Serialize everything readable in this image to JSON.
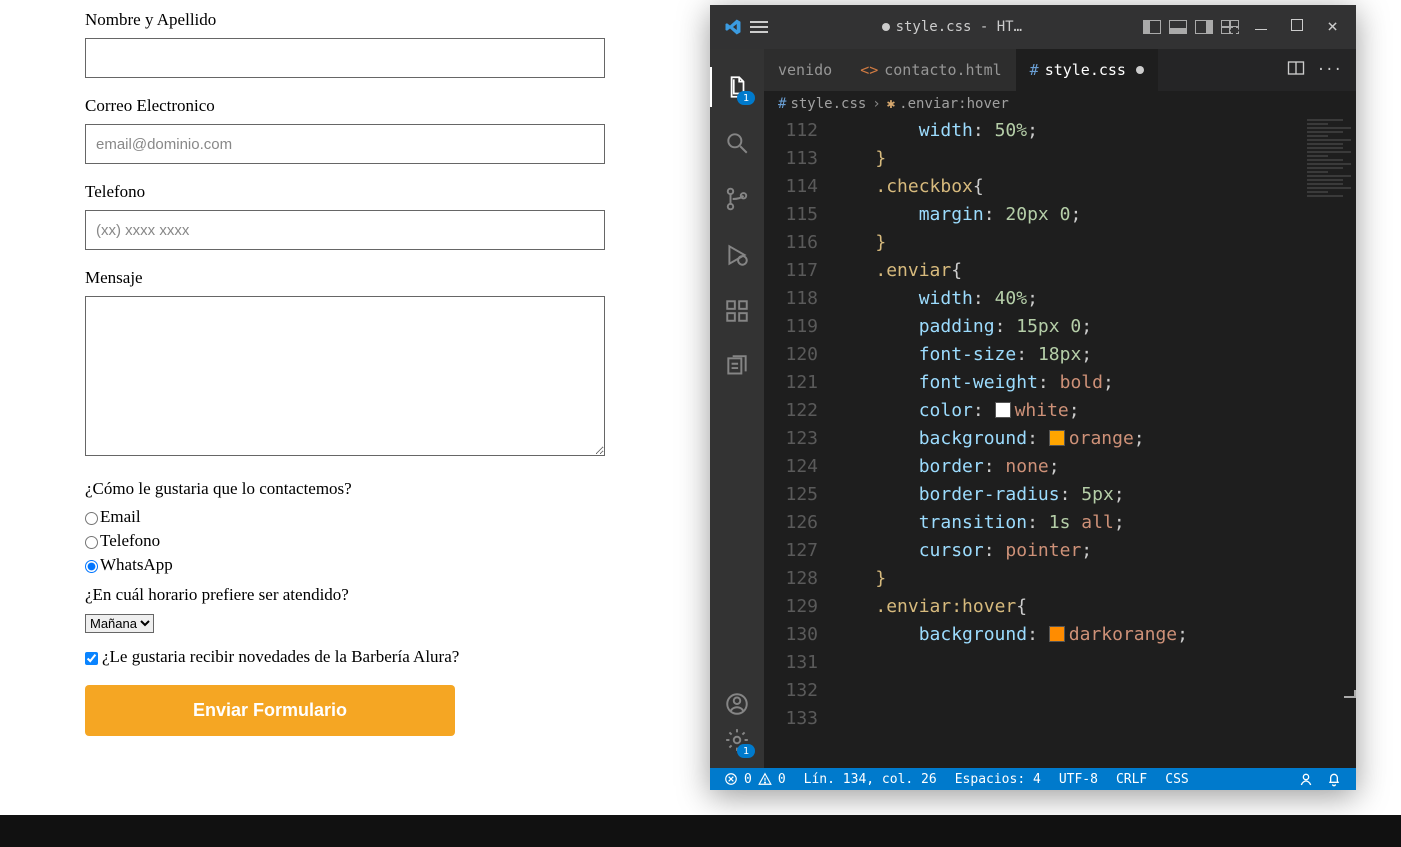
{
  "form": {
    "name_label": "Nombre y Apellido",
    "email_label": "Correo Electronico",
    "email_placeholder": "email@dominio.com",
    "phone_label": "Telefono",
    "phone_placeholder": "(xx) xxxx xxxx",
    "message_label": "Mensaje",
    "contact_question": "¿Cómo le gustaria que lo contactemos?",
    "radios": {
      "email": "Email",
      "telefono": "Telefono",
      "whatsapp": "WhatsApp"
    },
    "schedule_question": "¿En cuál horario prefiere ser atendido?",
    "schedule_selected": "Mañana",
    "newsletter": "¿Le gustaria recibir novedades de la Barbería Alura?",
    "submit": "Enviar Formulario"
  },
  "vscode": {
    "title": "style.css - HTML...",
    "actbar": {
      "explorer_badge": "1",
      "settings_badge": "1"
    },
    "tabs": {
      "welcome": "venido",
      "contacto": "contacto.html",
      "style": "style.css"
    },
    "breadcrumb": {
      "file": "style.css",
      "symbol": ".enviar:hover"
    },
    "lines": [
      {
        "n": "112",
        "ind": 2,
        "t": [
          [
            "prop",
            "width"
          ],
          [
            "punc",
            ": "
          ],
          [
            "num",
            "50%"
          ],
          [
            "punc",
            ";"
          ]
        ]
      },
      {
        "n": "113",
        "ind": 1,
        "t": [
          [
            "sel",
            "}"
          ]
        ]
      },
      {
        "n": "114",
        "ind": 0,
        "t": []
      },
      {
        "n": "115",
        "ind": 1,
        "t": [
          [
            "sel",
            ".checkbox"
          ],
          [
            "punc",
            "{"
          ]
        ]
      },
      {
        "n": "116",
        "ind": 2,
        "t": [
          [
            "prop",
            "margin"
          ],
          [
            "punc",
            ": "
          ],
          [
            "num",
            "20px 0"
          ],
          [
            "punc",
            ";"
          ]
        ]
      },
      {
        "n": "117",
        "ind": 1,
        "t": [
          [
            "sel",
            "}"
          ]
        ]
      },
      {
        "n": "118",
        "ind": 0,
        "t": []
      },
      {
        "n": "119",
        "ind": 1,
        "t": [
          [
            "sel",
            ".enviar"
          ],
          [
            "punc",
            "{"
          ]
        ]
      },
      {
        "n": "120",
        "ind": 2,
        "t": [
          [
            "prop",
            "width"
          ],
          [
            "punc",
            ": "
          ],
          [
            "num",
            "40%"
          ],
          [
            "punc",
            ";"
          ]
        ]
      },
      {
        "n": "121",
        "ind": 2,
        "t": [
          [
            "prop",
            "padding"
          ],
          [
            "punc",
            ": "
          ],
          [
            "num",
            "15px 0"
          ],
          [
            "punc",
            ";"
          ]
        ]
      },
      {
        "n": "122",
        "ind": 2,
        "t": [
          [
            "prop",
            "font-size"
          ],
          [
            "punc",
            ": "
          ],
          [
            "num",
            "18px"
          ],
          [
            "punc",
            ";"
          ]
        ]
      },
      {
        "n": "123",
        "ind": 2,
        "t": [
          [
            "prop",
            "font-weight"
          ],
          [
            "punc",
            ": "
          ],
          [
            "const",
            "bold"
          ],
          [
            "punc",
            ";"
          ]
        ]
      },
      {
        "n": "124",
        "ind": 2,
        "t": [
          [
            "prop",
            "color"
          ],
          [
            "punc",
            ": "
          ],
          [
            "swatch",
            "#ffffff"
          ],
          [
            "const",
            "white"
          ],
          [
            "punc",
            ";"
          ]
        ]
      },
      {
        "n": "125",
        "ind": 2,
        "t": [
          [
            "prop",
            "background"
          ],
          [
            "punc",
            ": "
          ],
          [
            "swatch",
            "#ffa500"
          ],
          [
            "const",
            "orange"
          ],
          [
            "punc",
            ";"
          ]
        ]
      },
      {
        "n": "126",
        "ind": 2,
        "t": [
          [
            "prop",
            "border"
          ],
          [
            "punc",
            ": "
          ],
          [
            "const",
            "none"
          ],
          [
            "punc",
            ";"
          ]
        ]
      },
      {
        "n": "127",
        "ind": 2,
        "t": [
          [
            "prop",
            "border-radius"
          ],
          [
            "punc",
            ": "
          ],
          [
            "num",
            "5px"
          ],
          [
            "punc",
            ";"
          ]
        ]
      },
      {
        "n": "128",
        "ind": 2,
        "t": [
          [
            "prop",
            "transition"
          ],
          [
            "punc",
            ": "
          ],
          [
            "num",
            "1s"
          ],
          [
            "punc",
            " "
          ],
          [
            "const",
            "all"
          ],
          [
            "punc",
            ";"
          ]
        ]
      },
      {
        "n": "129",
        "ind": 2,
        "t": [
          [
            "prop",
            "cursor"
          ],
          [
            "punc",
            ": "
          ],
          [
            "const",
            "pointer"
          ],
          [
            "punc",
            ";"
          ]
        ]
      },
      {
        "n": "130",
        "ind": 1,
        "t": [
          [
            "sel",
            "}"
          ]
        ]
      },
      {
        "n": "131",
        "ind": 0,
        "t": []
      },
      {
        "n": "132",
        "ind": 1,
        "t": [
          [
            "sel",
            ".enviar:hover"
          ],
          [
            "punc",
            "{"
          ]
        ]
      },
      {
        "n": "133",
        "ind": 2,
        "t": [
          [
            "prop",
            "background"
          ],
          [
            "punc",
            ": "
          ],
          [
            "swatch",
            "#ff8c00"
          ],
          [
            "const",
            "darkorange"
          ],
          [
            "punc",
            ";"
          ]
        ]
      }
    ],
    "status": {
      "errors": "0",
      "warnings": "0",
      "position": "Lín. 134, col. 26",
      "spaces": "Espacios: 4",
      "encoding": "UTF-8",
      "eol": "CRLF",
      "lang": "CSS"
    }
  }
}
